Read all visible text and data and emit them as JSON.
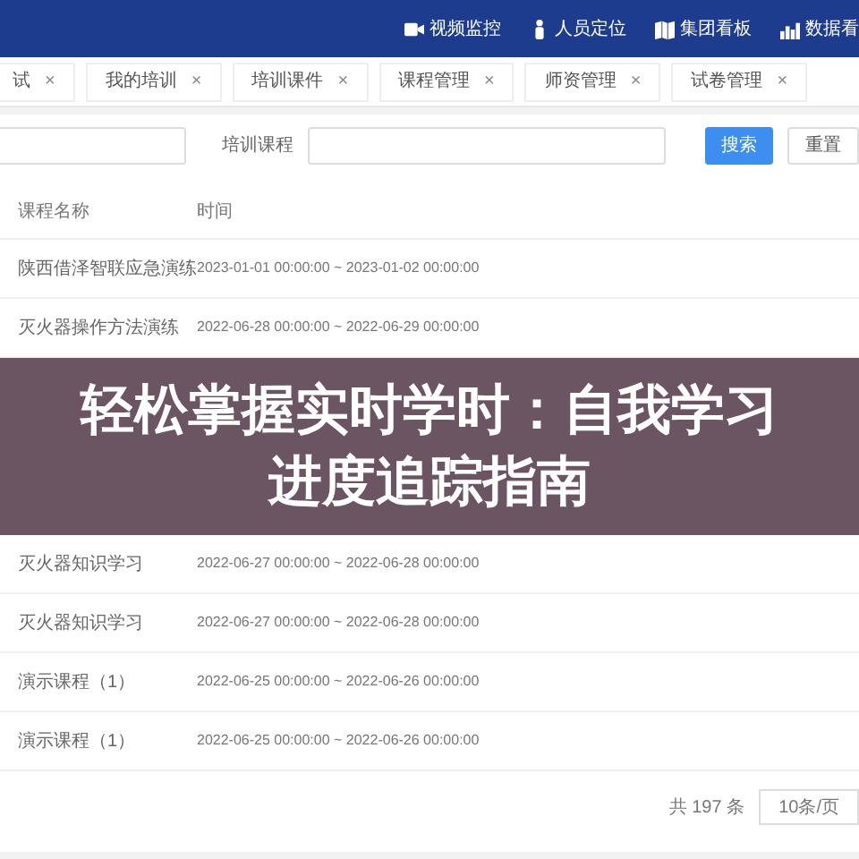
{
  "header": {
    "links": [
      {
        "kind": "video",
        "label": "视频监控"
      },
      {
        "kind": "person",
        "label": "人员定位"
      },
      {
        "kind": "map",
        "label": "集团看板"
      },
      {
        "kind": "chart",
        "label": "数据看"
      }
    ]
  },
  "tabs": [
    {
      "label": "试",
      "close": "×",
      "selected": false
    },
    {
      "label": "我的培训",
      "close": "×",
      "selected": false
    },
    {
      "label": "培训课件",
      "close": "×",
      "selected": false
    },
    {
      "label": "课程管理",
      "close": "×",
      "selected": false
    },
    {
      "label": "师资管理",
      "close": "×",
      "selected": false
    },
    {
      "label": "试卷管理",
      "close": "×",
      "selected": false
    }
  ],
  "filters": {
    "course_label": "培训课程",
    "search_button": "搜索",
    "reset_button": "重置"
  },
  "table": {
    "columns": [
      "课程名称",
      "时间"
    ],
    "rows": [
      {
        "name": "陕西借泽智联应急演练",
        "time": "2023-01-01 00:00:00 ~ 2023-01-02 00:00:00"
      },
      {
        "name": "灭火器操作方法演练",
        "time": "2022-06-28 00:00:00 ~ 2022-06-29 00:00:00"
      },
      {
        "kind": "banner",
        "lines": [
          "轻松掌握实时学时：自我学习",
          "进度追踪指南"
        ]
      },
      {
        "name": "灭火器知识学习",
        "time": "2022-06-27 00:00:00 ~ 2022-06-28 00:00:00"
      },
      {
        "name": "灭火器知识学习",
        "time": "2022-06-27 00:00:00 ~ 2022-06-28 00:00:00"
      },
      {
        "name": "演示课程（1）",
        "time": "2022-06-25 00:00:00 ~ 2022-06-26 00:00:00"
      },
      {
        "name": "演示课程（1）",
        "time": "2022-06-25 00:00:00 ~ 2022-06-26 00:00:00"
      }
    ]
  },
  "pagination": {
    "total": "共 197 条",
    "page_size": "10条/页"
  }
}
